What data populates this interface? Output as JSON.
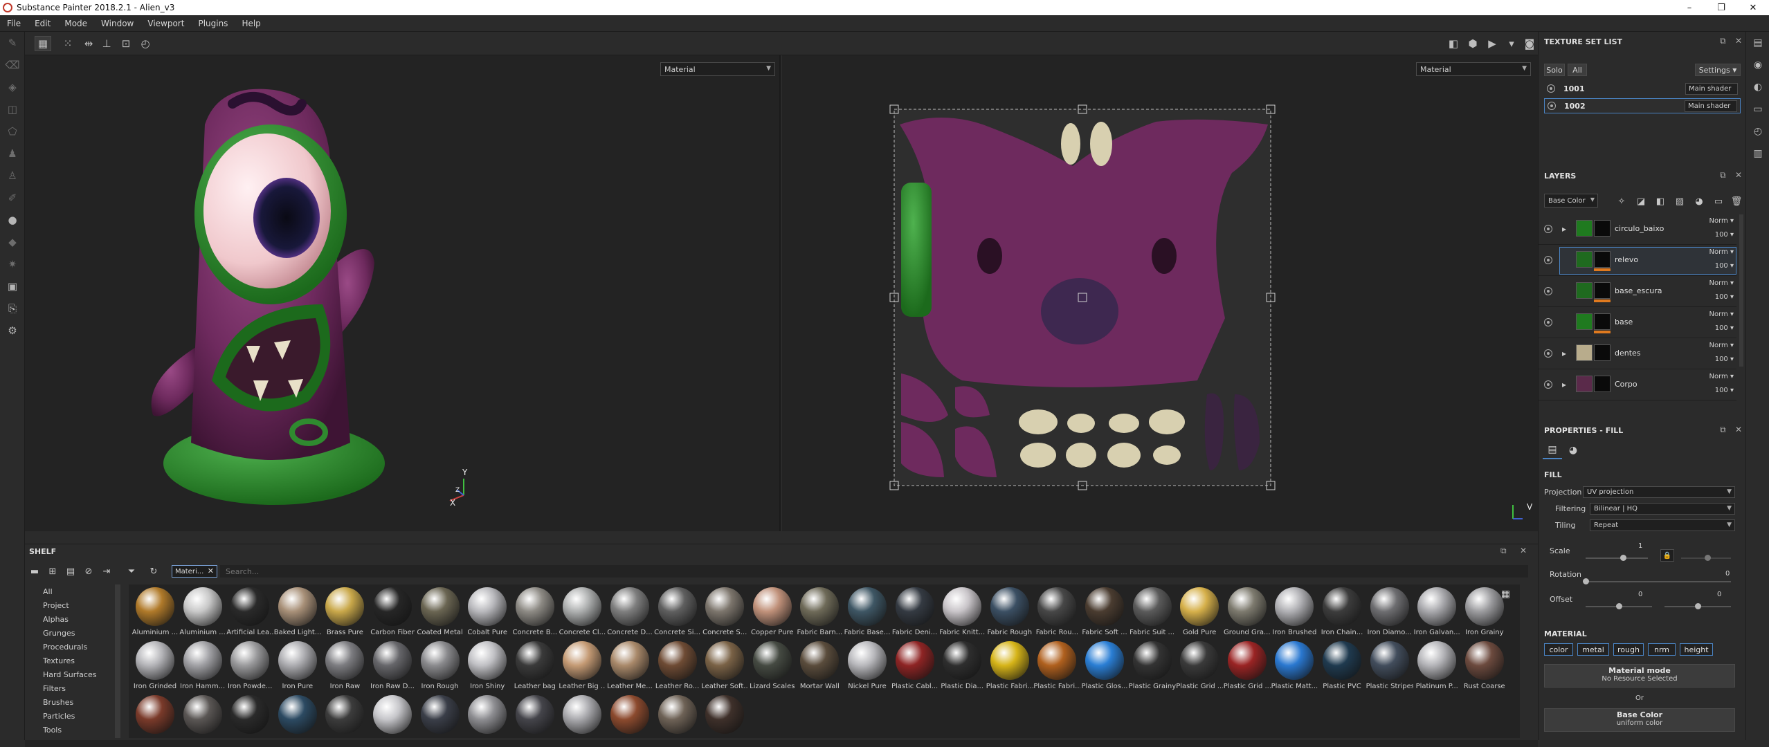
{
  "window": {
    "title": "Substance Painter 2018.2.1 - Alien_v3",
    "controls": [
      "–",
      "❐",
      "✕"
    ]
  },
  "menu": [
    "File",
    "Edit",
    "Mode",
    "Window",
    "Viewport",
    "Plugins",
    "Help"
  ],
  "viewports": {
    "left": {
      "mode": "Material",
      "axis_x": "X",
      "axis_y": "Y",
      "axis_z": "Z"
    },
    "right": {
      "mode": "Material",
      "axis_v": "V"
    }
  },
  "shelf": {
    "title": "SHELF",
    "filter_chip": "Materi...",
    "search_placeholder": "Search...",
    "categories": [
      "All",
      "Project",
      "Alphas",
      "Grunges",
      "Procedurals",
      "Textures",
      "Hard Surfaces",
      "Filters",
      "Brushes",
      "Particles",
      "Tools"
    ],
    "materials_row1": [
      {
        "name": "Aluminium ...",
        "color": "#b07a2a"
      },
      {
        "name": "Aluminium ...",
        "color": "#c8c8c8"
      },
      {
        "name": "Artificial Lea...",
        "color": "#2a2a2a"
      },
      {
        "name": "Baked Light...",
        "color": "#a89078"
      },
      {
        "name": "Brass Pure",
        "color": "#c9a84a"
      },
      {
        "name": "Carbon Fiber",
        "color": "#262626"
      },
      {
        "name": "Coated Metal",
        "color": "#6a6552"
      },
      {
        "name": "Cobalt Pure",
        "color": "#b8b8bc"
      },
      {
        "name": "Concrete B...",
        "color": "#8d8a84"
      },
      {
        "name": "Concrete Cl...",
        "color": "#aeb0b0"
      },
      {
        "name": "Concrete D...",
        "color": "#7e7e7e"
      },
      {
        "name": "Concrete Si...",
        "color": "#5f5f5f"
      },
      {
        "name": "Concrete S...",
        "color": "#7c756c"
      },
      {
        "name": "Copper Pure",
        "color": "#c0917a"
      },
      {
        "name": "Fabric Barn...",
        "color": "#6e6a58"
      },
      {
        "name": "Fabric Base...",
        "color": "#3e5664"
      },
      {
        "name": "Fabric Deni...",
        "color": "#343a42"
      },
      {
        "name": "Fabric Knitt...",
        "color": "#c8c4c8"
      },
      {
        "name": "Fabric Rough",
        "color": "#3b4f63"
      },
      {
        "name": "Fabric Rou...",
        "color": "#474747"
      },
      {
        "name": "Fabric Soft ...",
        "color": "#4a3c30"
      },
      {
        "name": "Fabric Suit ...",
        "color": "#5a5a5a"
      },
      {
        "name": "Gold Pure",
        "color": "#d6b04a"
      },
      {
        "name": "Ground Gra...",
        "color": "#7d7a6e"
      },
      {
        "name": "Iron Brushed",
        "color": "#b0b0b4"
      },
      {
        "name": "Iron Chain...",
        "color": "#3c3c3c"
      },
      {
        "name": "Iron Diamo...",
        "color": "#6d6d70"
      },
      {
        "name": "Iron Galvan...",
        "color": "#a8a8ac"
      },
      {
        "name": "Iron Grainy",
        "color": "#9c9c9f"
      }
    ],
    "materials_row2": [
      {
        "name": "Iron Grinded",
        "color": "#b4b4b8"
      },
      {
        "name": "Iron Hamm...",
        "color": "#a0a0a4"
      },
      {
        "name": "Iron Powde...",
        "color": "#9a9a9c"
      },
      {
        "name": "Iron Pure",
        "color": "#acacb0"
      },
      {
        "name": "Iron Raw",
        "color": "#7c7c80"
      },
      {
        "name": "Iron Raw D...",
        "color": "#66666a"
      },
      {
        "name": "Iron Rough",
        "color": "#8a8a8d"
      },
      {
        "name": "Iron Shiny",
        "color": "#c0c0c4"
      },
      {
        "name": "Leather bag",
        "color": "#3a3a3a"
      },
      {
        "name": "Leather Big ...",
        "color": "#c49a74"
      },
      {
        "name": "Leather Me...",
        "color": "#a9896a"
      },
      {
        "name": "Leather Ro...",
        "color": "#6e4b34"
      },
      {
        "name": "Leather Soft...",
        "color": "#7a6246"
      },
      {
        "name": "Lizard Scales",
        "color": "#454a42"
      },
      {
        "name": "Mortar Wall",
        "color": "#5a4c3c"
      },
      {
        "name": "Nickel Pure",
        "color": "#b8b8bc"
      },
      {
        "name": "Plastic Cabl...",
        "color": "#8e2424"
      },
      {
        "name": "Plastic Dia...",
        "color": "#2e2e2e"
      },
      {
        "name": "Plastic Fabri...",
        "color": "#d6b418"
      },
      {
        "name": "Plastic Fabri...",
        "color": "#b0601e"
      },
      {
        "name": "Plastic Glos...",
        "color": "#2a7ed4"
      },
      {
        "name": "Plastic Grainy",
        "color": "#333333"
      },
      {
        "name": "Plastic Grid ...",
        "color": "#3a3a3a"
      },
      {
        "name": "Plastic Grid ...",
        "color": "#9a2424"
      },
      {
        "name": "Plastic Matt...",
        "color": "#2a78d0"
      },
      {
        "name": "Plastic PVC",
        "color": "#1f3a4f"
      },
      {
        "name": "Plastic Stripes",
        "color": "#424d5c"
      },
      {
        "name": "Platinum P...",
        "color": "#b4b4b8"
      },
      {
        "name": "Rust Coarse",
        "color": "#6c4a3e"
      }
    ],
    "materials_row3": [
      {
        "name": "",
        "color": "#7a3a2a"
      },
      {
        "name": "",
        "color": "#5a5654"
      },
      {
        "name": "",
        "color": "#2a2a2a"
      },
      {
        "name": "",
        "color": "#2c4a62"
      },
      {
        "name": "",
        "color": "#3c3c3c"
      },
      {
        "name": "",
        "color": "#c6c6ca"
      },
      {
        "name": "",
        "color": "#3a3e48"
      },
      {
        "name": "",
        "color": "#8e8e92"
      },
      {
        "name": "",
        "color": "#44444a"
      },
      {
        "name": "",
        "color": "#aaaaae"
      },
      {
        "name": "",
        "color": "#8c4a2e"
      },
      {
        "name": "",
        "color": "#6e6256"
      },
      {
        "name": "",
        "color": "#3e302a"
      }
    ]
  },
  "texture_set_list": {
    "title": "TEXTURE SET LIST",
    "solo_label": "Solo",
    "all_label": "All",
    "settings_label": "Settings",
    "sets": [
      {
        "name": "1001",
        "shader": "Main shader"
      },
      {
        "name": "1002",
        "shader": "Main shader"
      }
    ]
  },
  "layers": {
    "title": "LAYERS",
    "channel": "Base Color",
    "items": [
      {
        "name": "circulo_baixo",
        "blend": "Norm",
        "opacity": "100",
        "thumb": "#1f7a1f",
        "folder": true
      },
      {
        "name": "relevo",
        "blend": "Norm",
        "opacity": "100",
        "thumb": "#1f6a1f",
        "folder": false
      },
      {
        "name": "base_escura",
        "blend": "Norm",
        "opacity": "100",
        "thumb": "#1f6a1f",
        "folder": false
      },
      {
        "name": "base",
        "blend": "Norm",
        "opacity": "100",
        "thumb": "#1f7a1f",
        "folder": false
      },
      {
        "name": "dentes",
        "blend": "Norm",
        "opacity": "100",
        "thumb": "#b8ac8c",
        "folder": true
      },
      {
        "name": "Corpo",
        "blend": "Norm",
        "opacity": "100",
        "thumb": "#5a2a4a",
        "folder": true
      }
    ]
  },
  "properties": {
    "title": "PROPERTIES - FILL",
    "fill_section": "FILL",
    "projection_label": "Projection",
    "projection_value": "UV projection",
    "filtering_label": "Filtering",
    "filtering_value": "Bilinear | HQ",
    "tiling_label": "Tiling",
    "tiling_value": "Repeat",
    "scale_label": "Scale",
    "scale_value": "1",
    "rotation_label": "Rotation",
    "rotation_value": "0",
    "offset_label": "Offset",
    "offset_u": "0",
    "offset_v": "0",
    "material_section": "MATERIAL",
    "channels": [
      "color",
      "metal",
      "rough",
      "nrm",
      "height"
    ],
    "material_mode_label": "Material mode",
    "material_mode_value": "No Resource Selected",
    "or_label": "Or",
    "base_color_label": "Base Color",
    "base_color_value": "uniform color"
  },
  "colors": {
    "accent": "#4a84c4",
    "mask_bar": "#e07a1f",
    "body_purple": "#7a2d68",
    "green": "#2f8a2f"
  }
}
